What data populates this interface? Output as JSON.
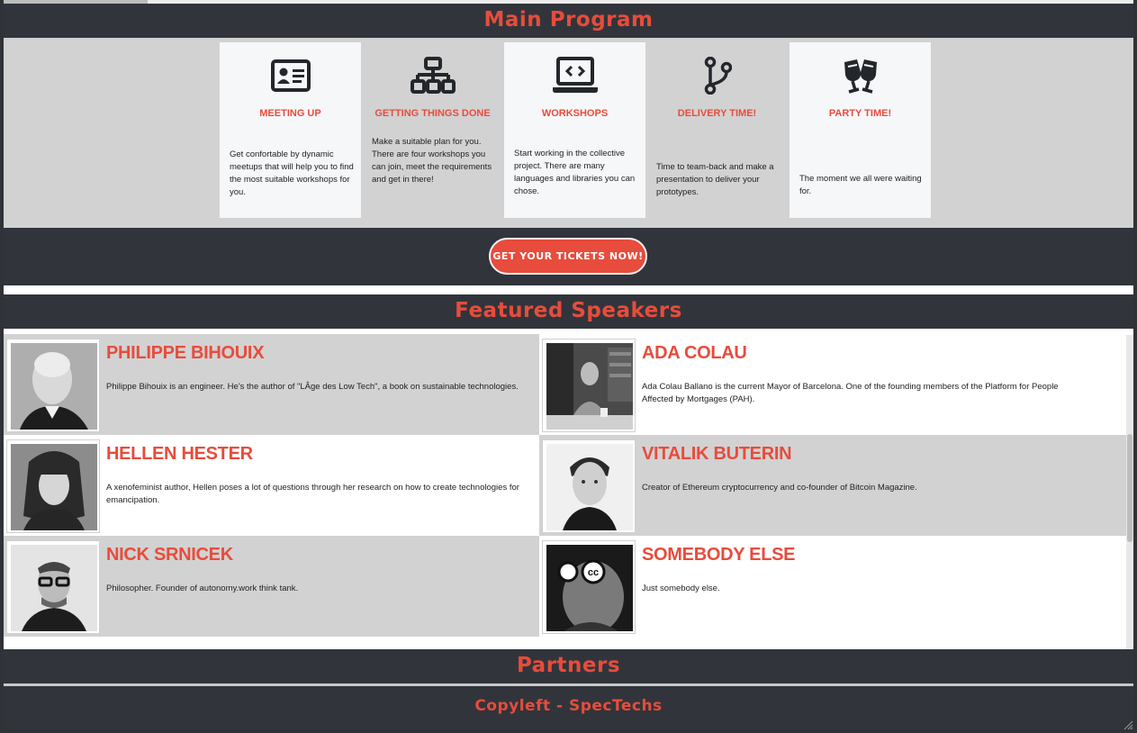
{
  "sections": {
    "main_program": "Main Program",
    "featured_speakers": "Featured Speakers",
    "partners": "Partners",
    "footer": "Copyleft - SpecTechs"
  },
  "program": [
    {
      "icon": "id-card-icon",
      "title": "MEETING UP",
      "desc": "Get confortable by dynamic meetups that will help you to find the most suitable workshops for you."
    },
    {
      "icon": "sitemap-icon",
      "title": "GETTING THINGS DONE",
      "desc": "Make a suitable plan for you. There are four workshops you can join, meet the requirements and get in there!"
    },
    {
      "icon": "laptop-code-icon",
      "title": "WORKSHOPS",
      "desc": "Start working in the collective project. There are many languages and libraries you can chose."
    },
    {
      "icon": "code-branch-icon",
      "title": "DELIVERY TIME!",
      "desc": "Time to team-back and make a presentation to deliver your prototypes."
    },
    {
      "icon": "glass-cheers-icon",
      "title": "PARTY TIME!",
      "desc": "The moment we all were waiting for."
    }
  ],
  "ticket_button": "GET YOUR TICKETS NOW!",
  "speakers": [
    {
      "name": "PHILIPPE BIHOUIX",
      "bio": "Philippe Bihouix is an engineer. He's the author of \"LÂge des Low Tech\", a book on sustainable technologies."
    },
    {
      "name": "ADA COLAU",
      "bio": "Ada Colau Ballano is the current Mayor of Barcelona. One of the founding members of the Platform for People Affected by Mortgages (PAH)."
    },
    {
      "name": "HELLEN HESTER",
      "bio": "A xenofeminist author, Hellen poses a lot of questions through her research on how to create technologies for emancipation."
    },
    {
      "name": "VITALIK BUTERIN",
      "bio": "Creator of Ethereum cryptocurrency and co-founder of Bitcoin Magazine."
    },
    {
      "name": "NICK SRNICEK",
      "bio": "Philosopher. Founder of autonomy.work think tank."
    },
    {
      "name": "SOMEBODY ELSE",
      "bio": "Just somebody else."
    }
  ],
  "colors": {
    "accent": "#e74c3c",
    "dark": "#31353b",
    "gray": "#d2d2d2"
  }
}
